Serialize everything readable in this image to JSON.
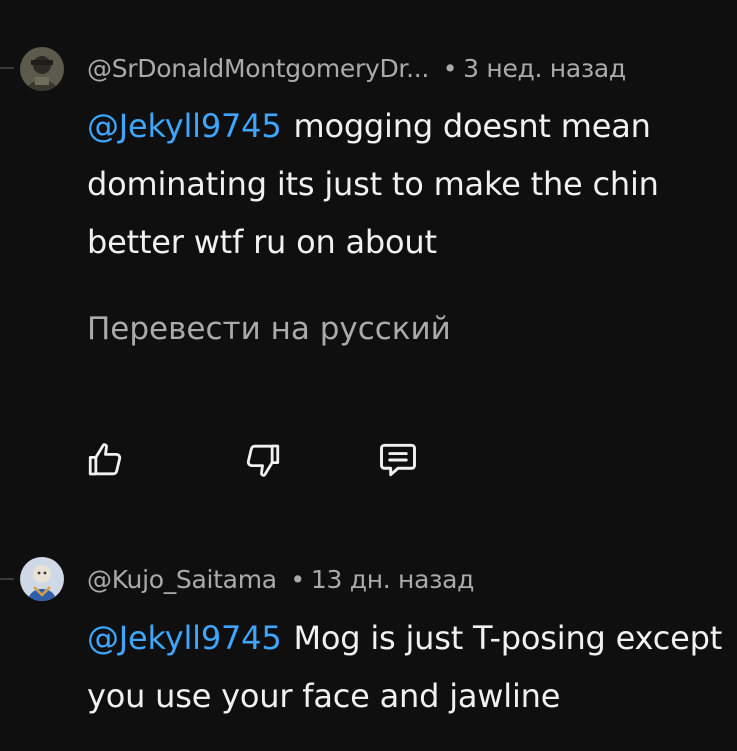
{
  "comments": [
    {
      "author": "@SrDonaldMontgomeryDr...",
      "time": "3 нед. назад",
      "mention": "@Jekyll9745",
      "text": "mogging doesnt mean dominating its just to make the chin better wtf ru on about",
      "translate": "Перевести на русский"
    },
    {
      "author": "@Kujo_Saitama",
      "time": "13 дн. назад",
      "mention": "@Jekyll9745",
      "text": "Mog is just T-posing except you use your face and jawline"
    }
  ],
  "separator": "•",
  "icons": [
    "like-icon",
    "dislike-icon",
    "reply-icon"
  ]
}
